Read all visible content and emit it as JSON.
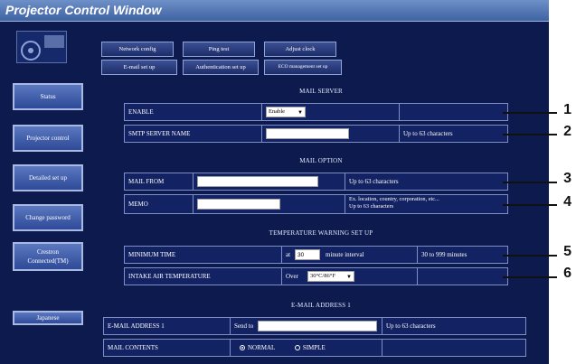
{
  "window": {
    "title": "Projector Control Window"
  },
  "sidebar": {
    "items": [
      {
        "label": "Status"
      },
      {
        "label": "Projector control"
      },
      {
        "label": "Detailed set up"
      },
      {
        "label": "Change password"
      },
      {
        "label": "Crestron Connected(TM)"
      },
      {
        "label": "Japanese"
      }
    ]
  },
  "tabs": {
    "row1": [
      {
        "label": "Network config"
      },
      {
        "label": "Ping test"
      },
      {
        "label": "Adjust clock"
      }
    ],
    "row2": [
      {
        "label": "E-mail set up"
      },
      {
        "label": "Authentication set up"
      },
      {
        "label": "ECO management set up"
      }
    ]
  },
  "mail_server": {
    "title": "MAIL SERVER",
    "enable_label": "ENABLE",
    "enable_value": "Enable",
    "smtp_label": "SMTP SERVER NAME",
    "smtp_value": "",
    "smtp_hint": "Up to 63 characters"
  },
  "mail_option": {
    "title": "MAIL OPTION",
    "from_label": "MAIL FROM",
    "from_value": "",
    "from_hint": "Up to 63 characters",
    "memo_label": "MEMO",
    "memo_value": "",
    "memo_hint_1": "Ex. location, country, corporation, etc...",
    "memo_hint_2": "Up to 63 characters"
  },
  "temperature": {
    "title": "TEMPERATURE WARNING SET UP",
    "min_time_label": "MINIMUM TIME",
    "at_label": "at",
    "min_time_value": "30",
    "interval_label": "minute interval",
    "min_time_hint": "30 to 999 minutes",
    "intake_label": "INTAKE AIR TEMPERATURE",
    "over_label": "Over",
    "intake_value": "30°C/86°F"
  },
  "email_address_1": {
    "title": "E-MAIL ADDRESS 1",
    "address_label": "E-MAIL ADDRESS 1",
    "send_to_label": "Send to",
    "address_value": "",
    "address_hint": "Up to 63 characters",
    "contents_label": "MAIL CONTENTS",
    "normal_label": "NORMAL",
    "simple_label": "SIMPLE"
  },
  "callouts": [
    "1",
    "2",
    "3",
    "4",
    "5",
    "6"
  ]
}
